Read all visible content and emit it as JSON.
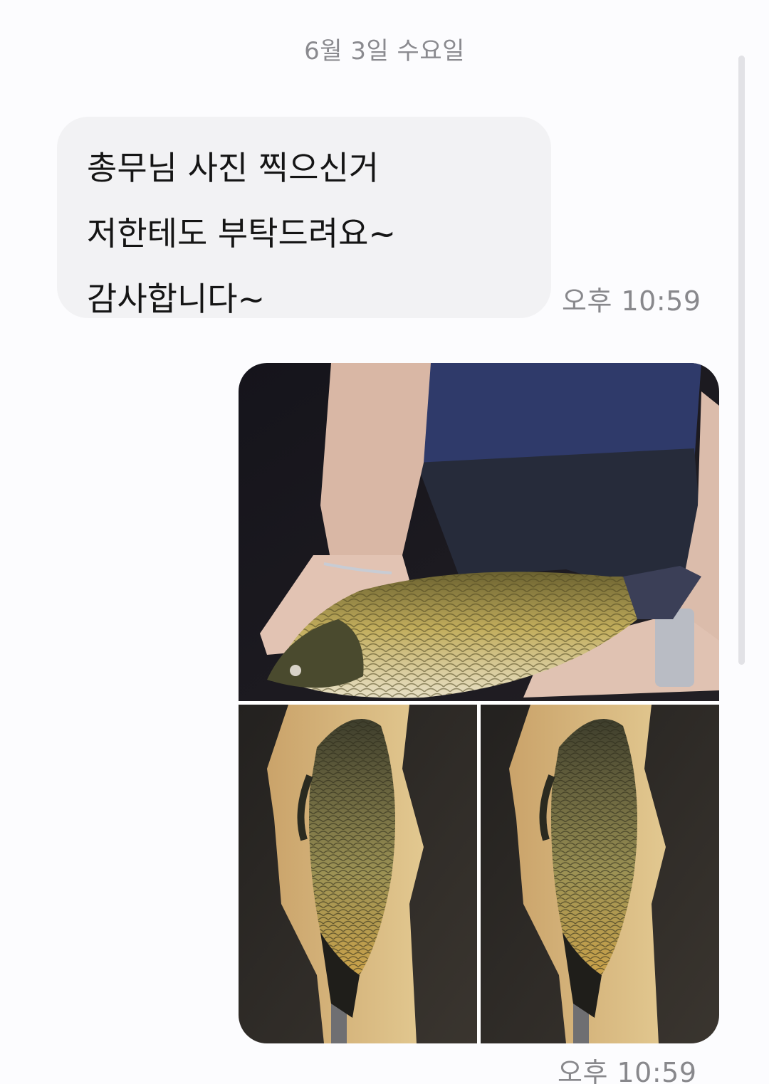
{
  "conversation": {
    "date_separator": "6월 3일 수요일",
    "incoming_message": {
      "lines": [
        "총무님 사진 찍으신거",
        "저한테도 부탁드려요~",
        "감사합니다~"
      ],
      "time": "오후 10:59"
    },
    "outgoing_photos": {
      "count": 3,
      "time": "오후 10:59"
    }
  },
  "colors": {
    "background": "#fcfcfe",
    "incoming_bubble": "#f2f2f4",
    "timestamp_text": "#88888c",
    "date_text": "#8a8a8f"
  }
}
